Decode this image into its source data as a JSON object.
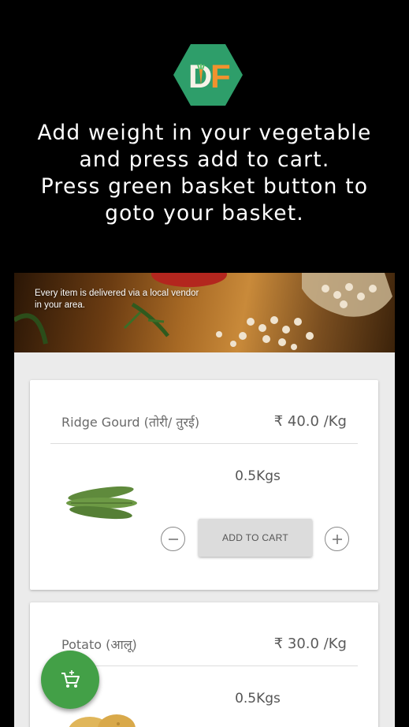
{
  "intro": {
    "message": "Add weight in your vegetable\nand press add to cart.\nPress green basket button to\ngoto your basket."
  },
  "banner": {
    "text": "Every item is delivered via a local vendor\nin your area."
  },
  "products": [
    {
      "name": "Ridge Gourd (तोरी/ तुरई)",
      "price": "₹ 40.0 /Kg",
      "weight": "0.5Kgs",
      "add_label": "ADD TO CART",
      "image_icon": "ridge-gourd-image"
    },
    {
      "name": "Potato (आलू)",
      "price": "₹ 30.0 /Kg",
      "weight": "0.5Kgs",
      "image_icon": "potato-image"
    }
  ],
  "controls": {
    "minus_icon": "minus-circle-icon",
    "plus_icon": "plus-circle-icon",
    "basket_icon": "basket-cart-icon"
  },
  "colors": {
    "logo_green": "#2e9e6a",
    "logo_orange": "#f2922e",
    "fab_green": "#43a047"
  }
}
